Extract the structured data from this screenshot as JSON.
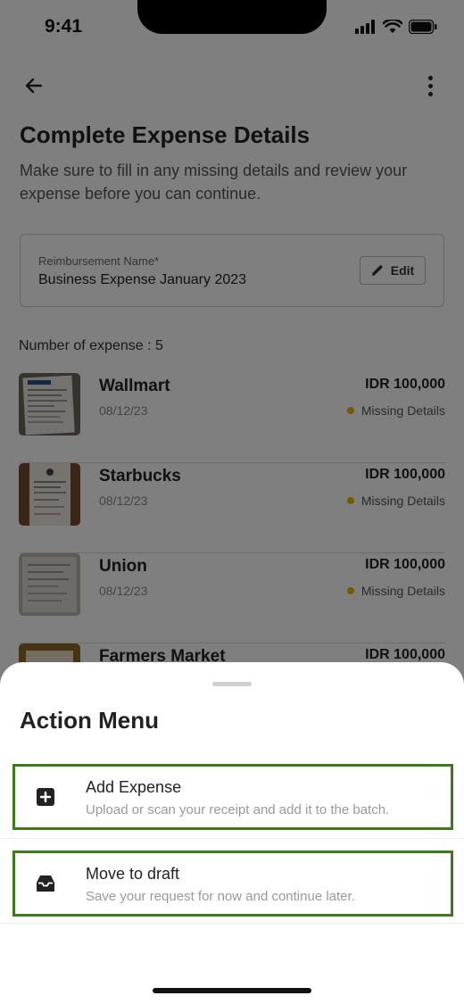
{
  "status_bar": {
    "time": "9:41"
  },
  "page": {
    "title": "Complete Expense Details",
    "subtitle": "Make sure to fill in any missing details and review your expense before you can continue.",
    "reimbursement": {
      "label": "Reimbursement Name*",
      "value": "Business Expense January 2023",
      "edit_label": "Edit"
    },
    "count_label": "Number of expense : 5",
    "expenses": [
      {
        "name": "Wallmart",
        "date": "08/12/23",
        "amount": "IDR 100,000",
        "status": "Missing Details"
      },
      {
        "name": "Starbucks",
        "date": "08/12/23",
        "amount": "IDR 100,000",
        "status": "Missing Details"
      },
      {
        "name": "Union",
        "date": "08/12/23",
        "amount": "IDR 100,000",
        "status": "Missing Details"
      },
      {
        "name": "Farmers Market",
        "date": "",
        "amount": "IDR 100,000",
        "status": ""
      }
    ]
  },
  "action_menu": {
    "title": "Action Menu",
    "items": [
      {
        "title": "Add Expense",
        "description": "Upload or scan your receipt and add it to the batch.",
        "icon": "add-square-icon"
      },
      {
        "title": "Move to draft",
        "description": "Save your request for now and continue later.",
        "icon": "inbox-icon"
      }
    ]
  },
  "colors": {
    "status_dot": "#e8b600",
    "highlight_border": "#3d7a1d",
    "overlay": "rgba(0,0,0,0.5)"
  }
}
